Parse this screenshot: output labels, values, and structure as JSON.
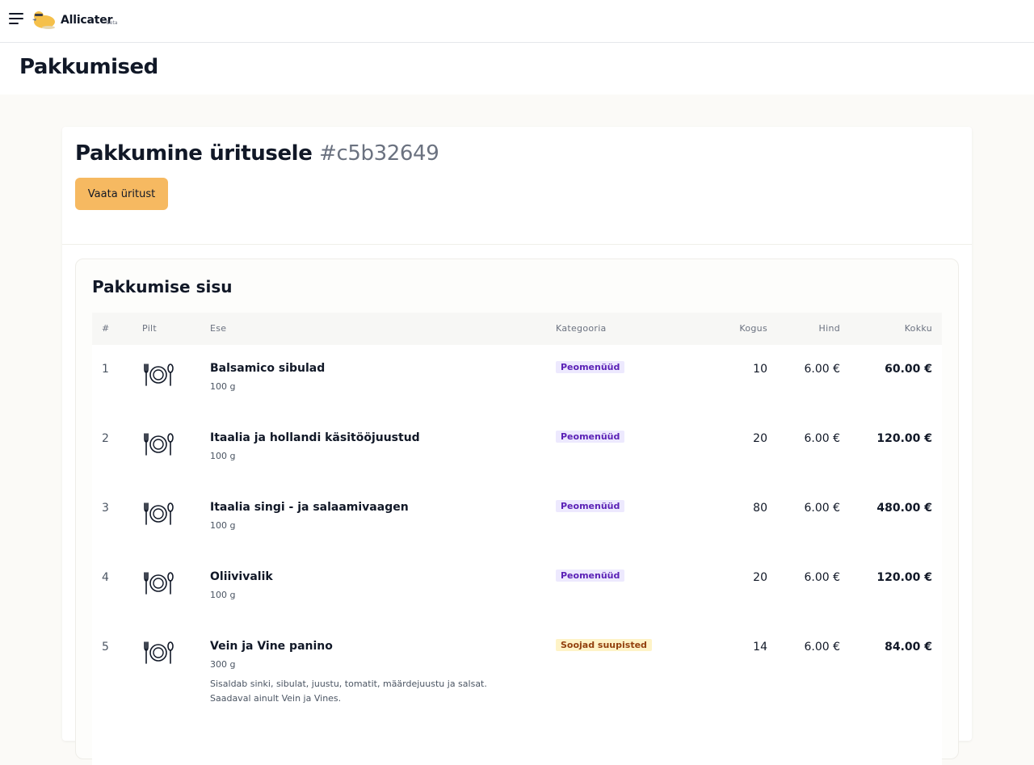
{
  "app": {
    "brand": "Allicater",
    "beta": "beta"
  },
  "page": {
    "title": "Pakkumised"
  },
  "offer": {
    "title": "Pakkumine üritusele",
    "reference": "#c5b32649",
    "view_event_button": "Vaata üritust"
  },
  "contents": {
    "title": "Pakkumise sisu",
    "headers": {
      "num": "#",
      "picture": "Pilt",
      "item": "Ese",
      "category": "Kategooria",
      "quantity": "Kogus",
      "price": "Hind",
      "total": "Kokku"
    },
    "rows": [
      {
        "num": "1",
        "icon": "plate-cutlery-icon",
        "name": "Balsamico sibulad",
        "weight": "100 g",
        "desc1": "",
        "desc2": "",
        "category": "Peomenüüd",
        "category_color": "purple",
        "qty": "10",
        "price": "6.00 €",
        "total": "60.00 €"
      },
      {
        "num": "2",
        "icon": "plate-cutlery-icon",
        "name": "Itaalia ja hollandi käsitööjuustud",
        "weight": "100 g",
        "desc1": "",
        "desc2": "",
        "category": "Peomenüüd",
        "category_color": "purple",
        "qty": "20",
        "price": "6.00 €",
        "total": "120.00 €"
      },
      {
        "num": "3",
        "icon": "plate-cutlery-icon",
        "name": "Itaalia singi - ja salaamivaagen",
        "weight": "100 g",
        "desc1": "",
        "desc2": "",
        "category": "Peomenüüd",
        "category_color": "purple",
        "qty": "80",
        "price": "6.00 €",
        "total": "480.00 €"
      },
      {
        "num": "4",
        "icon": "plate-cutlery-icon",
        "name": "Oliivivalik",
        "weight": "100 g",
        "desc1": "",
        "desc2": "",
        "category": "Peomenüüd",
        "category_color": "purple",
        "qty": "20",
        "price": "6.00 €",
        "total": "120.00 €"
      },
      {
        "num": "5",
        "icon": "plate-cutlery-icon",
        "name": "Vein ja Vine panino",
        "weight": "300 g",
        "desc1": "Sisaldab sinki, sibulat, juustu, tomatit, määrdejuustu ja salsat.",
        "desc2": "Saadaval ainult Vein ja Vines.",
        "category": "Soojad suupisted",
        "category_color": "yellow",
        "qty": "14",
        "price": "6.00 €",
        "total": "84.00 €"
      }
    ]
  },
  "colors": {
    "accent": "#f6b961",
    "category_purple_bg": "#ede9fe",
    "category_purple_text": "#5b21b6",
    "category_yellow_bg": "#fef3c7",
    "category_yellow_text": "#92400e"
  }
}
